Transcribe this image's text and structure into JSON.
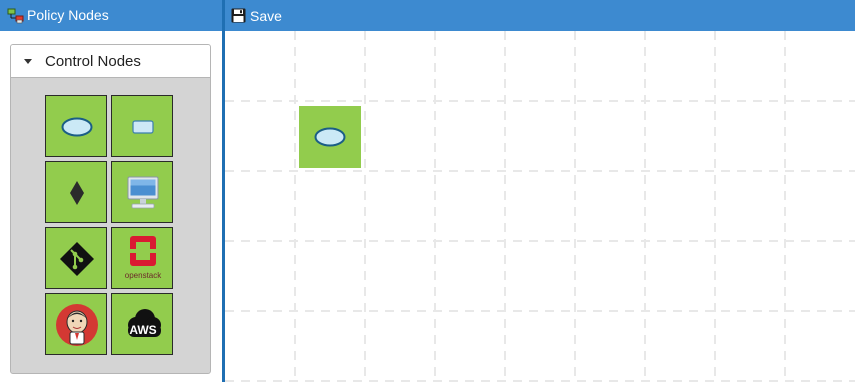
{
  "sidebar": {
    "header_icon": "policy-nodes-icon",
    "title": "Policy Nodes",
    "panel": {
      "title": "Control Nodes",
      "expanded": true,
      "items": [
        {
          "name": "ellipse-node",
          "icon": "ellipse-icon"
        },
        {
          "name": "rectangle-node",
          "icon": "rounded-rectangle-icon"
        },
        {
          "name": "diamond-node",
          "icon": "diamond-icon"
        },
        {
          "name": "computer-node",
          "icon": "monitor-icon"
        },
        {
          "name": "git-node",
          "icon": "git-icon"
        },
        {
          "name": "openstack-node",
          "icon": "openstack-icon",
          "logo_text": "openstack"
        },
        {
          "name": "jenkins-node",
          "icon": "jenkins-icon"
        },
        {
          "name": "aws-node",
          "icon": "aws-icon",
          "logo_text": "AWS"
        }
      ]
    }
  },
  "toolbar": {
    "save_icon": "floppy-disk-icon",
    "save_label": "Save"
  },
  "canvas": {
    "nodes": [
      {
        "name": "canvas-ellipse-node",
        "icon": "ellipse-icon"
      }
    ]
  },
  "colors": {
    "header_blue": "#3d8ad0",
    "divider_blue": "#1f6fb3",
    "tile_green": "#92cc4d",
    "panel_gray": "#d4d4d4",
    "grid_line": "#e8e8e8"
  }
}
